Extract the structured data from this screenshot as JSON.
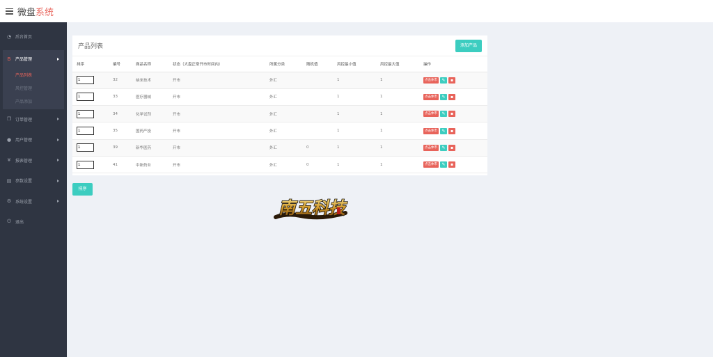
{
  "header": {
    "brand_main": "微盘",
    "brand_accent": "系统"
  },
  "sidebar": {
    "items": [
      {
        "label": "后台首页",
        "icon": "dashboard-icon"
      },
      {
        "label": "产品管理",
        "icon": "product-icon",
        "sub": [
          "产品列表",
          "风控管理",
          "产品添加"
        ]
      },
      {
        "label": "订单管理",
        "icon": "orders-icon"
      },
      {
        "label": "用户管理",
        "icon": "user-icon"
      },
      {
        "label": "报表管理",
        "icon": "yen-icon"
      },
      {
        "label": "参数设置",
        "icon": "params-icon"
      },
      {
        "label": "系统设置",
        "icon": "gear-icon"
      },
      {
        "label": "退出",
        "icon": "power-icon"
      }
    ]
  },
  "panel": {
    "title": "产品列表",
    "add_button": "添加产品",
    "columns": [
      "排序",
      "编号",
      "商品名称",
      "状态（大盘正常开市时间内）",
      "所属分类",
      "随机值",
      "风控最小值",
      "风控最大值",
      "操作"
    ],
    "rows": [
      {
        "sort": "1",
        "id": "32",
        "name": "纳米技术",
        "status": "开市",
        "category": "外汇",
        "random": "",
        "min": "1",
        "max": "1"
      },
      {
        "sort": "1",
        "id": "33",
        "name": "医疗器械",
        "status": "开市",
        "category": "外汇",
        "random": "",
        "min": "1",
        "max": "1"
      },
      {
        "sort": "1",
        "id": "34",
        "name": "化学试剂",
        "status": "开市",
        "category": "外汇",
        "random": "",
        "min": "1",
        "max": "1"
      },
      {
        "sort": "1",
        "id": "35",
        "name": "国药产投",
        "status": "开市",
        "category": "外汇",
        "random": "",
        "min": "1",
        "max": "1"
      },
      {
        "sort": "1",
        "id": "39",
        "name": "新华医药",
        "status": "开市",
        "category": "外汇",
        "random": "0",
        "min": "1",
        "max": "1"
      },
      {
        "sort": "1",
        "id": "41",
        "name": "中新药业",
        "status": "开市",
        "category": "外汇",
        "random": "0",
        "min": "1",
        "max": "1"
      }
    ],
    "action_label": "点击休市"
  },
  "sort_button": "排序",
  "watermark": {
    "text": "南五科技"
  },
  "colors": {
    "accent_red": "#e8635a",
    "accent_teal": "#3ccdc0",
    "sidebar_bg": "#2f3542"
  }
}
